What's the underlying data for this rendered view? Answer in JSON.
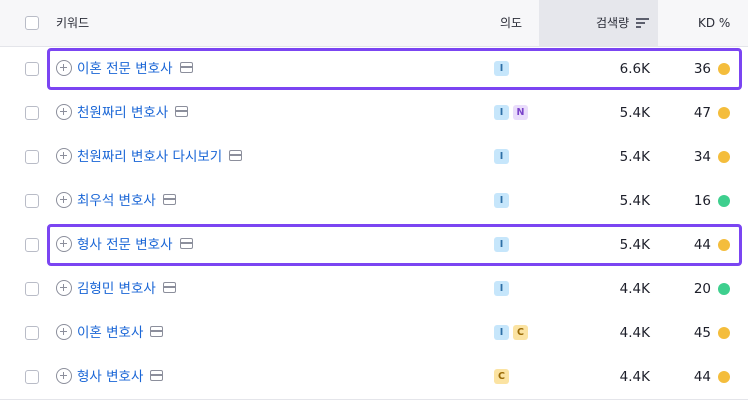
{
  "header": {
    "keyword": "키워드",
    "intent": "의도",
    "volume": "검색량",
    "kd": "KD %"
  },
  "colors": {
    "link": "#1a66d6",
    "kd_yellow": "#f4bd3c",
    "kd_green": "#3ecf8e",
    "highlight": "#7b45f2"
  },
  "rows": [
    {
      "keyword": "이혼 전문 변호사",
      "intents": [
        "I"
      ],
      "volume": "6.6K",
      "kd": "36",
      "kd_color": "yellow",
      "highlighted": true
    },
    {
      "keyword": "천원짜리 변호사",
      "intents": [
        "I",
        "N"
      ],
      "volume": "5.4K",
      "kd": "47",
      "kd_color": "yellow",
      "highlighted": false
    },
    {
      "keyword": "천원짜리 변호사 다시보기",
      "intents": [
        "I"
      ],
      "volume": "5.4K",
      "kd": "34",
      "kd_color": "yellow",
      "highlighted": false
    },
    {
      "keyword": "최우석 변호사",
      "intents": [
        "I"
      ],
      "volume": "5.4K",
      "kd": "16",
      "kd_color": "green",
      "highlighted": false
    },
    {
      "keyword": "형사 전문 변호사",
      "intents": [
        "I"
      ],
      "volume": "5.4K",
      "kd": "44",
      "kd_color": "yellow",
      "highlighted": true
    },
    {
      "keyword": "김형민 변호사",
      "intents": [
        "I"
      ],
      "volume": "4.4K",
      "kd": "20",
      "kd_color": "green",
      "highlighted": false
    },
    {
      "keyword": "이혼 변호사",
      "intents": [
        "I",
        "C"
      ],
      "volume": "4.4K",
      "kd": "45",
      "kd_color": "yellow",
      "highlighted": false
    },
    {
      "keyword": "형사 변호사",
      "intents": [
        "C"
      ],
      "volume": "4.4K",
      "kd": "44",
      "kd_color": "yellow",
      "highlighted": false
    }
  ]
}
